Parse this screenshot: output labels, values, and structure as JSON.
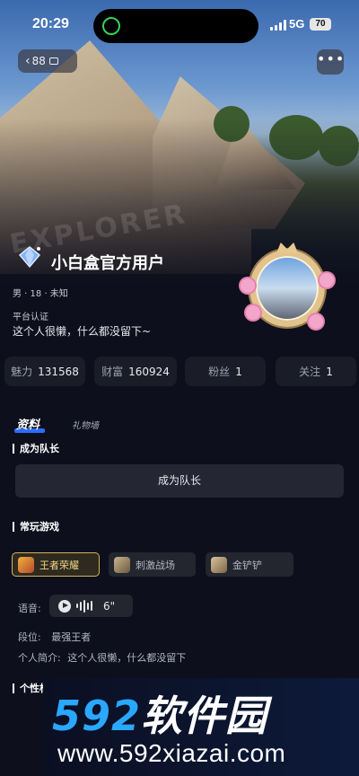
{
  "status_bar": {
    "time": "20:29",
    "network": "5G",
    "battery": "70"
  },
  "nav": {
    "back_count": "88",
    "more_label": "•••"
  },
  "hero": {
    "logo_text": "EXPLORER"
  },
  "profile": {
    "username": "小白盒官方用户",
    "sub_info": "男 · 18 · 未知",
    "certification": "平台认证",
    "bio": "这个人很懒，什么都没留下~"
  },
  "stats": [
    {
      "label": "魅力",
      "value": "131568"
    },
    {
      "label": "财富",
      "value": "160924"
    },
    {
      "label": "粉丝",
      "value": "1"
    },
    {
      "label": "关注",
      "value": "1"
    }
  ],
  "tabs": {
    "active": "资料",
    "other": "礼物墙"
  },
  "captain": {
    "section_title": "成为队长",
    "button_label": "成为队长"
  },
  "games": {
    "section_title": "常玩游戏",
    "items": [
      {
        "name": "王者荣耀",
        "selected": true
      },
      {
        "name": "刺激战场",
        "selected": false
      },
      {
        "name": "金铲铲",
        "selected": false
      }
    ]
  },
  "voice": {
    "label": "语音:",
    "duration": "6\""
  },
  "rank": {
    "label": "段位:",
    "value": "最强王者"
  },
  "intro": {
    "label": "个人简介:",
    "value": "这个人很懒，什么都没留下"
  },
  "personality": {
    "section_title": "个性标签"
  },
  "watermark": {
    "title_num": "592",
    "title_text": "软件园",
    "url": "www.592xiazai.com"
  },
  "colors": {
    "background": "#0d0f1c",
    "accent": "#2b6cff",
    "gold": "#d8b35a"
  }
}
